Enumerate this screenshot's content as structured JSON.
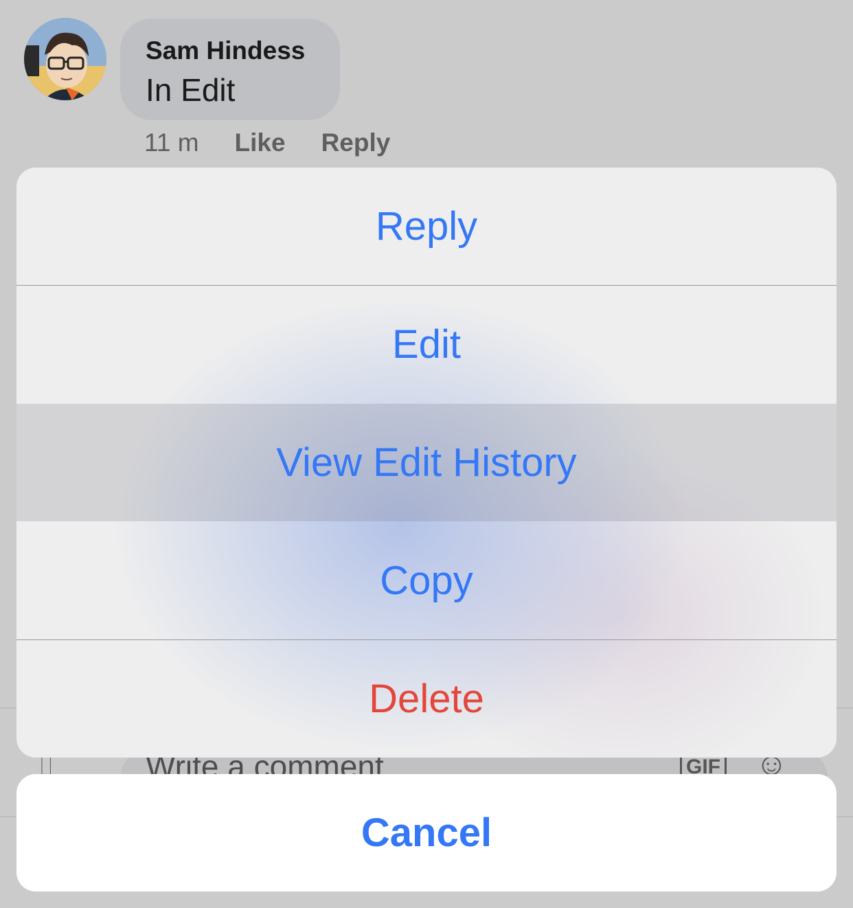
{
  "comment": {
    "author": "Sam Hindess",
    "text": "In Edit",
    "time": "11 m",
    "like_label": "Like",
    "reply_label": "Reply"
  },
  "composer": {
    "placeholder": "Write a comment...",
    "gif_label": "GIF",
    "camera_icon": "camera-icon",
    "emoji_icon": "emoji-icon"
  },
  "action_sheet": {
    "items": [
      {
        "label": "Reply"
      },
      {
        "label": "Edit"
      },
      {
        "label": "View Edit History"
      },
      {
        "label": "Copy"
      },
      {
        "label": "Delete"
      }
    ],
    "cancel_label": "Cancel"
  },
  "colors": {
    "action": "#3478f6",
    "destructive": "#e3463a",
    "dim_background": "#cbcbcb"
  }
}
